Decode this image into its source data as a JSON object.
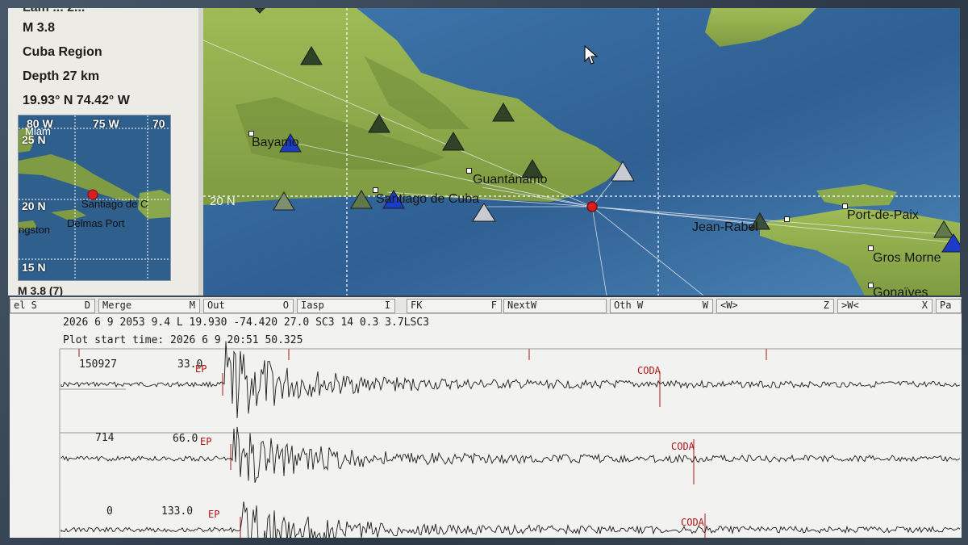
{
  "event_panel": {
    "cut_line": "Lam ... 2...",
    "magnitude": "M  3.8",
    "region": "Cuba Region",
    "depth": "Depth  27 km",
    "coords": "19.93° N  74.42° W",
    "footer": "M        3.8 (7)"
  },
  "mini_map": {
    "lon_labels": [
      "80 W",
      "75 W",
      "70"
    ],
    "lat_labels": [
      "25 N",
      "20 N",
      "15 N"
    ],
    "cities": [
      "Santiago de C",
      "Delmas  Port",
      "ngston",
      "Miam"
    ]
  },
  "main_map": {
    "lat_label": "20 N",
    "cities": [
      "Bayamo",
      "Guantánamo",
      "Santiago de Cuba",
      "Jean-Rabel",
      "Port-de-Paix",
      "Gros Morne",
      "Gonaïves"
    ]
  },
  "toolbar": {
    "buttons": [
      {
        "label": "el S",
        "key": "D"
      },
      {
        "label": "Merge",
        "key": "M"
      },
      {
        "label": "Out",
        "key": "O"
      },
      {
        "label": "Iasp",
        "key": "I"
      },
      {
        "label": "FK",
        "key": "F"
      },
      {
        "label": "NextW",
        "key": ""
      },
      {
        "label": "Oth W",
        "key": "W"
      },
      {
        "label": "<W>",
        "key": "Z"
      },
      {
        "label": ">W<",
        "key": "X"
      },
      {
        "label": "Pa",
        "key": ""
      }
    ]
  },
  "seismogram": {
    "header_line": "2026  6 9 2053   9.4 L    19.930  -74.420 27.0   SC3 14 0.3 3.7LSC3",
    "plot_start": "Plot start time: 2026   6   9    20:51   50.325",
    "traces": [
      {
        "id": "150927",
        "dist": "33.0",
        "p_pick": "EP",
        "coda_pick": "CODA"
      },
      {
        "id": "714",
        "dist": "66.0",
        "p_pick": "EP",
        "coda_pick": "CODA"
      },
      {
        "id": "0",
        "dist": "133.0",
        "p_pick": "EP",
        "coda_pick": "CODA"
      }
    ]
  },
  "colors": {
    "land": "#8fae4a",
    "sea": "#3c6fa0",
    "station_active": "#1a3cc8",
    "station_inactive": "#35492a",
    "epicenter": "#d81e1e",
    "pick": "#b01515"
  }
}
